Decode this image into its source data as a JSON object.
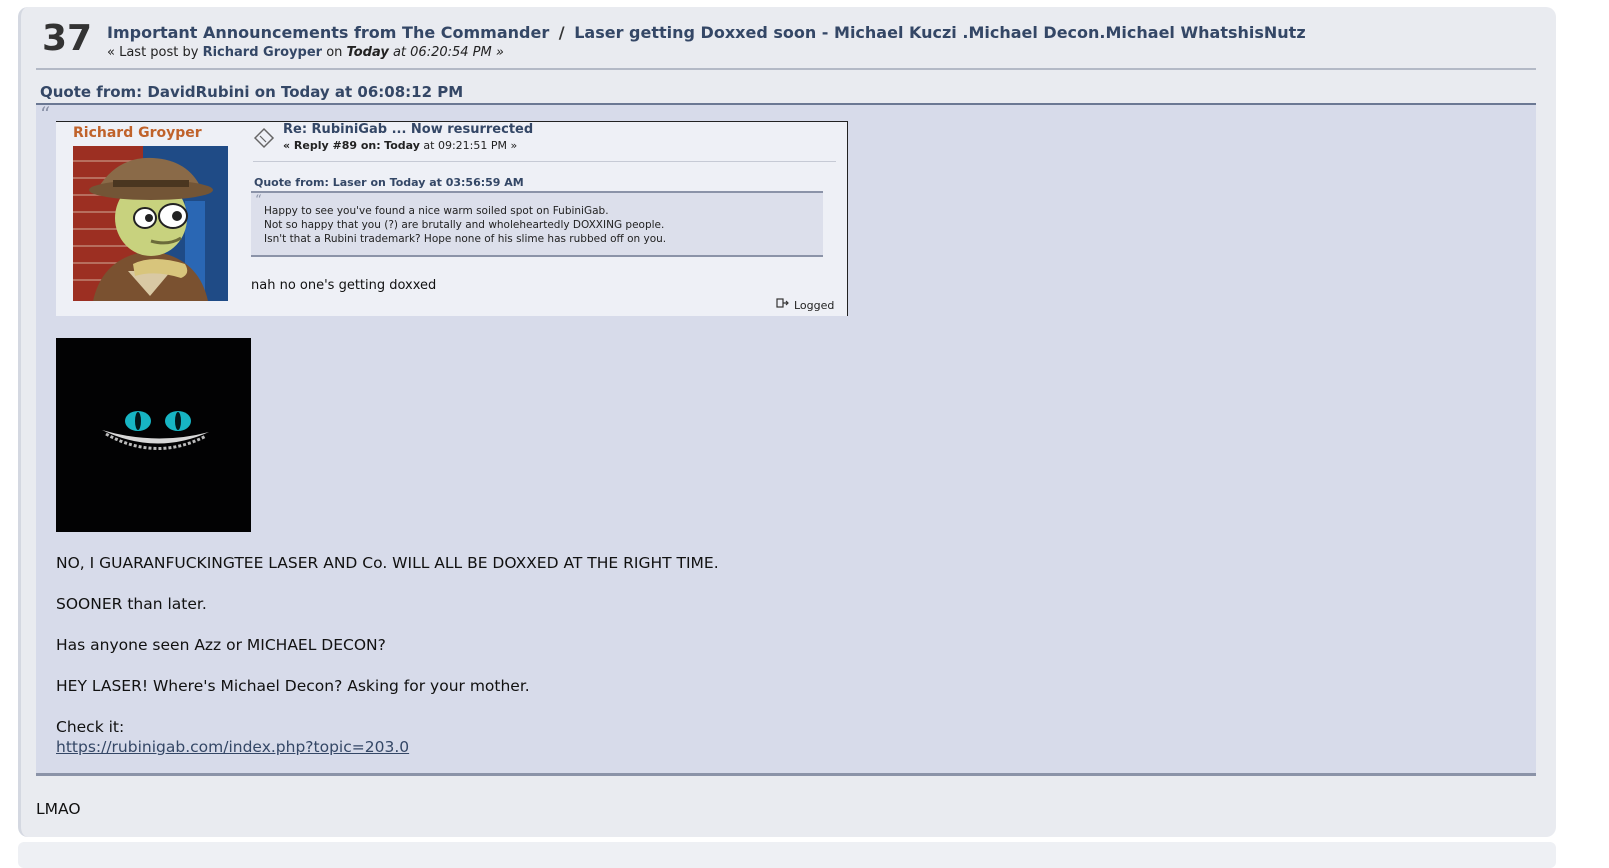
{
  "post": {
    "counter": "37",
    "board": "Important Announcements from The Commander",
    "separator": "/",
    "topic": "Laser getting Doxxed soon - Michael Kuczi .Michael Decon.Michael WhatshisNutz",
    "meta_prefix": "« Last post by",
    "meta_author": "Richard Groyper",
    "meta_on": "on",
    "meta_today": "Today",
    "meta_time": "at 06:20:54 PM »"
  },
  "quote": {
    "header": "Quote from: DavidRubini on Today at 06:08:12 PM",
    "mark": "“",
    "embed": {
      "author": "Richard Groyper",
      "title": "Re: RubiniGab ... Now resurrected",
      "reply_prefix": "« Reply #89 on:",
      "reply_today": "Today",
      "reply_time": "at 09:21:51 PM »",
      "inner_quote_header": "Quote from: Laser on Today at 03:56:59 AM",
      "inner_quote_lines": [
        "Happy to see you've found a nice warm soiled spot on FubiniGab.",
        "Not so happy that you (?) are brutally and wholeheartedly DOXXING people.",
        "Isn't that a Rubini trademark? Hope none of his slime has rubbed off on you."
      ],
      "body": "nah no one's getting doxxed",
      "logged": "Logged"
    },
    "lines": [
      "NO, I GUARANFUCKINGTEE LASER AND Co. WILL ALL BE DOXXED AT THE RIGHT TIME.",
      "SOONER than later.",
      "Has anyone seen Azz or MICHAEL DECON?",
      "HEY LASER! Where's Michael Decon? Asking for your mother.",
      "Check it:"
    ],
    "link": "https://rubinigab.com/index.php?topic=203.0"
  },
  "reply": {
    "text": "LMAO"
  },
  "colors": {
    "link": "#344766",
    "author_orange": "#c0622a",
    "card_bg": "#e9ebf0",
    "quote_bg": "#d7dbea"
  }
}
